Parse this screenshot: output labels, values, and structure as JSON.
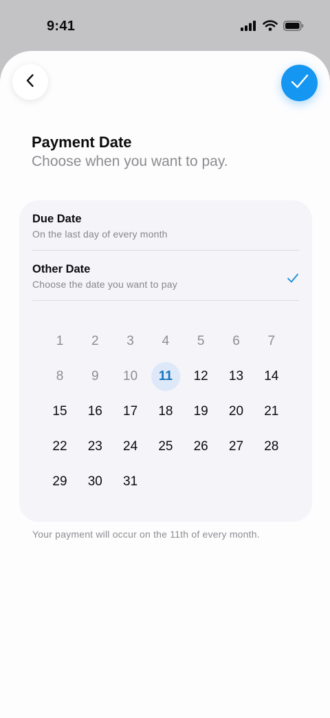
{
  "status_bar": {
    "time": "9:41",
    "icons": [
      "cellular-signal-icon",
      "wifi-icon",
      "battery-icon"
    ]
  },
  "header": {
    "back_icon": "chevron-left-icon",
    "confirm_icon": "checkmark-icon",
    "title": "Payment Date",
    "subtitle": "Choose when you want to pay."
  },
  "options": [
    {
      "title": "Due Date",
      "description": "On the last day of every month",
      "selected": false
    },
    {
      "title": "Other Date",
      "description": "Choose the date you want to pay",
      "selected": true
    }
  ],
  "calendar": {
    "days": [
      "1",
      "2",
      "3",
      "4",
      "5",
      "6",
      "7",
      "8",
      "9",
      "10",
      "11",
      "12",
      "13",
      "14",
      "15",
      "16",
      "17",
      "18",
      "19",
      "20",
      "21",
      "22",
      "23",
      "24",
      "25",
      "26",
      "27",
      "28",
      "29",
      "30",
      "31"
    ],
    "selected_day": "11",
    "disabled_days": [
      "1",
      "2",
      "3",
      "4",
      "5",
      "6",
      "7",
      "8",
      "9",
      "10"
    ]
  },
  "footnote": "Your payment will occur on the 11th of every month.",
  "colors": {
    "accent": "#1596f0",
    "selected_day_bg": "#dde8f8",
    "selected_day_text": "#1272bf",
    "card_bg": "#f4f4f9",
    "muted_text": "#8d8d92"
  }
}
